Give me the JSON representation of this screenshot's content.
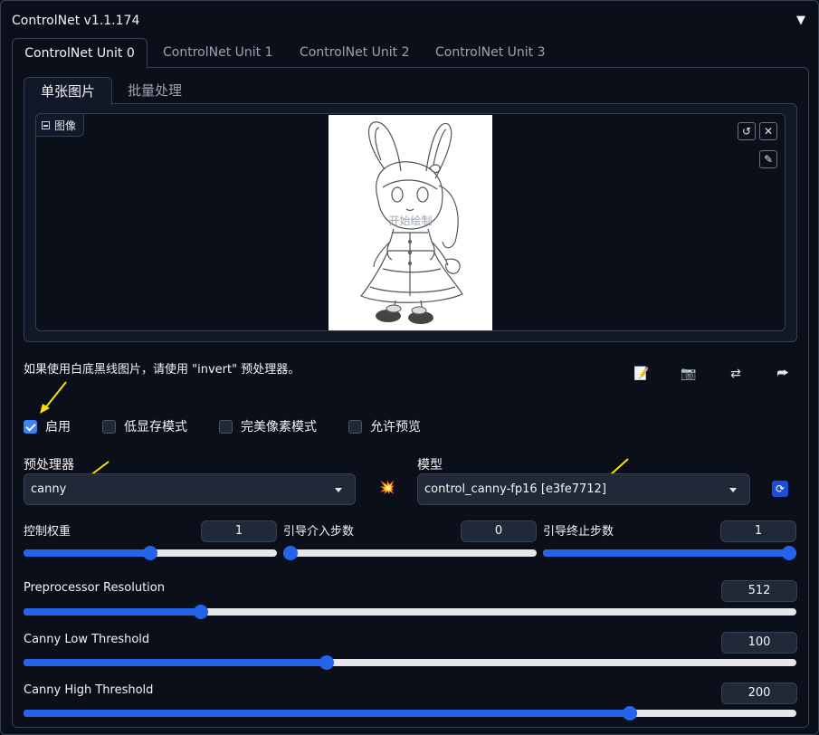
{
  "header": {
    "title": "ControlNet v1.1.174"
  },
  "unit_tabs": [
    "ControlNet Unit 0",
    "ControlNet Unit 1",
    "ControlNet Unit 2",
    "ControlNet Unit 3"
  ],
  "sub_tabs": [
    "单张图片",
    "批量处理"
  ],
  "image": {
    "label": "图像",
    "overlay": "开始绘制"
  },
  "hint": "如果使用白底黑线图片，请使用 \"invert\" 预处理器。",
  "checkboxes": [
    {
      "label": "启用",
      "checked": true
    },
    {
      "label": "低显存模式",
      "checked": false
    },
    {
      "label": "完美像素模式",
      "checked": false
    },
    {
      "label": "允许预览",
      "checked": false
    }
  ],
  "preprocessor": {
    "label": "预处理器",
    "value": "canny"
  },
  "model": {
    "label": "模型",
    "value": "control_canny-fp16 [e3fe7712]"
  },
  "sliders_row": [
    {
      "label": "控制权重",
      "value": "1",
      "fraction": 0.5
    },
    {
      "label": "引导介入步数",
      "value": "0",
      "fraction": 0.0
    },
    {
      "label": "引导终止步数",
      "value": "1",
      "fraction": 1.0
    }
  ],
  "sliders": [
    {
      "label": "Preprocessor Resolution",
      "value": "512",
      "fraction": 0.23
    },
    {
      "label": "Canny Low Threshold",
      "value": "100",
      "fraction": 0.392
    },
    {
      "label": "Canny High Threshold",
      "value": "200",
      "fraction": 0.784
    }
  ],
  "colors": {
    "accent": "#2563eb",
    "background": "#0b0f19",
    "annotation_arrow": "#f5e400"
  }
}
